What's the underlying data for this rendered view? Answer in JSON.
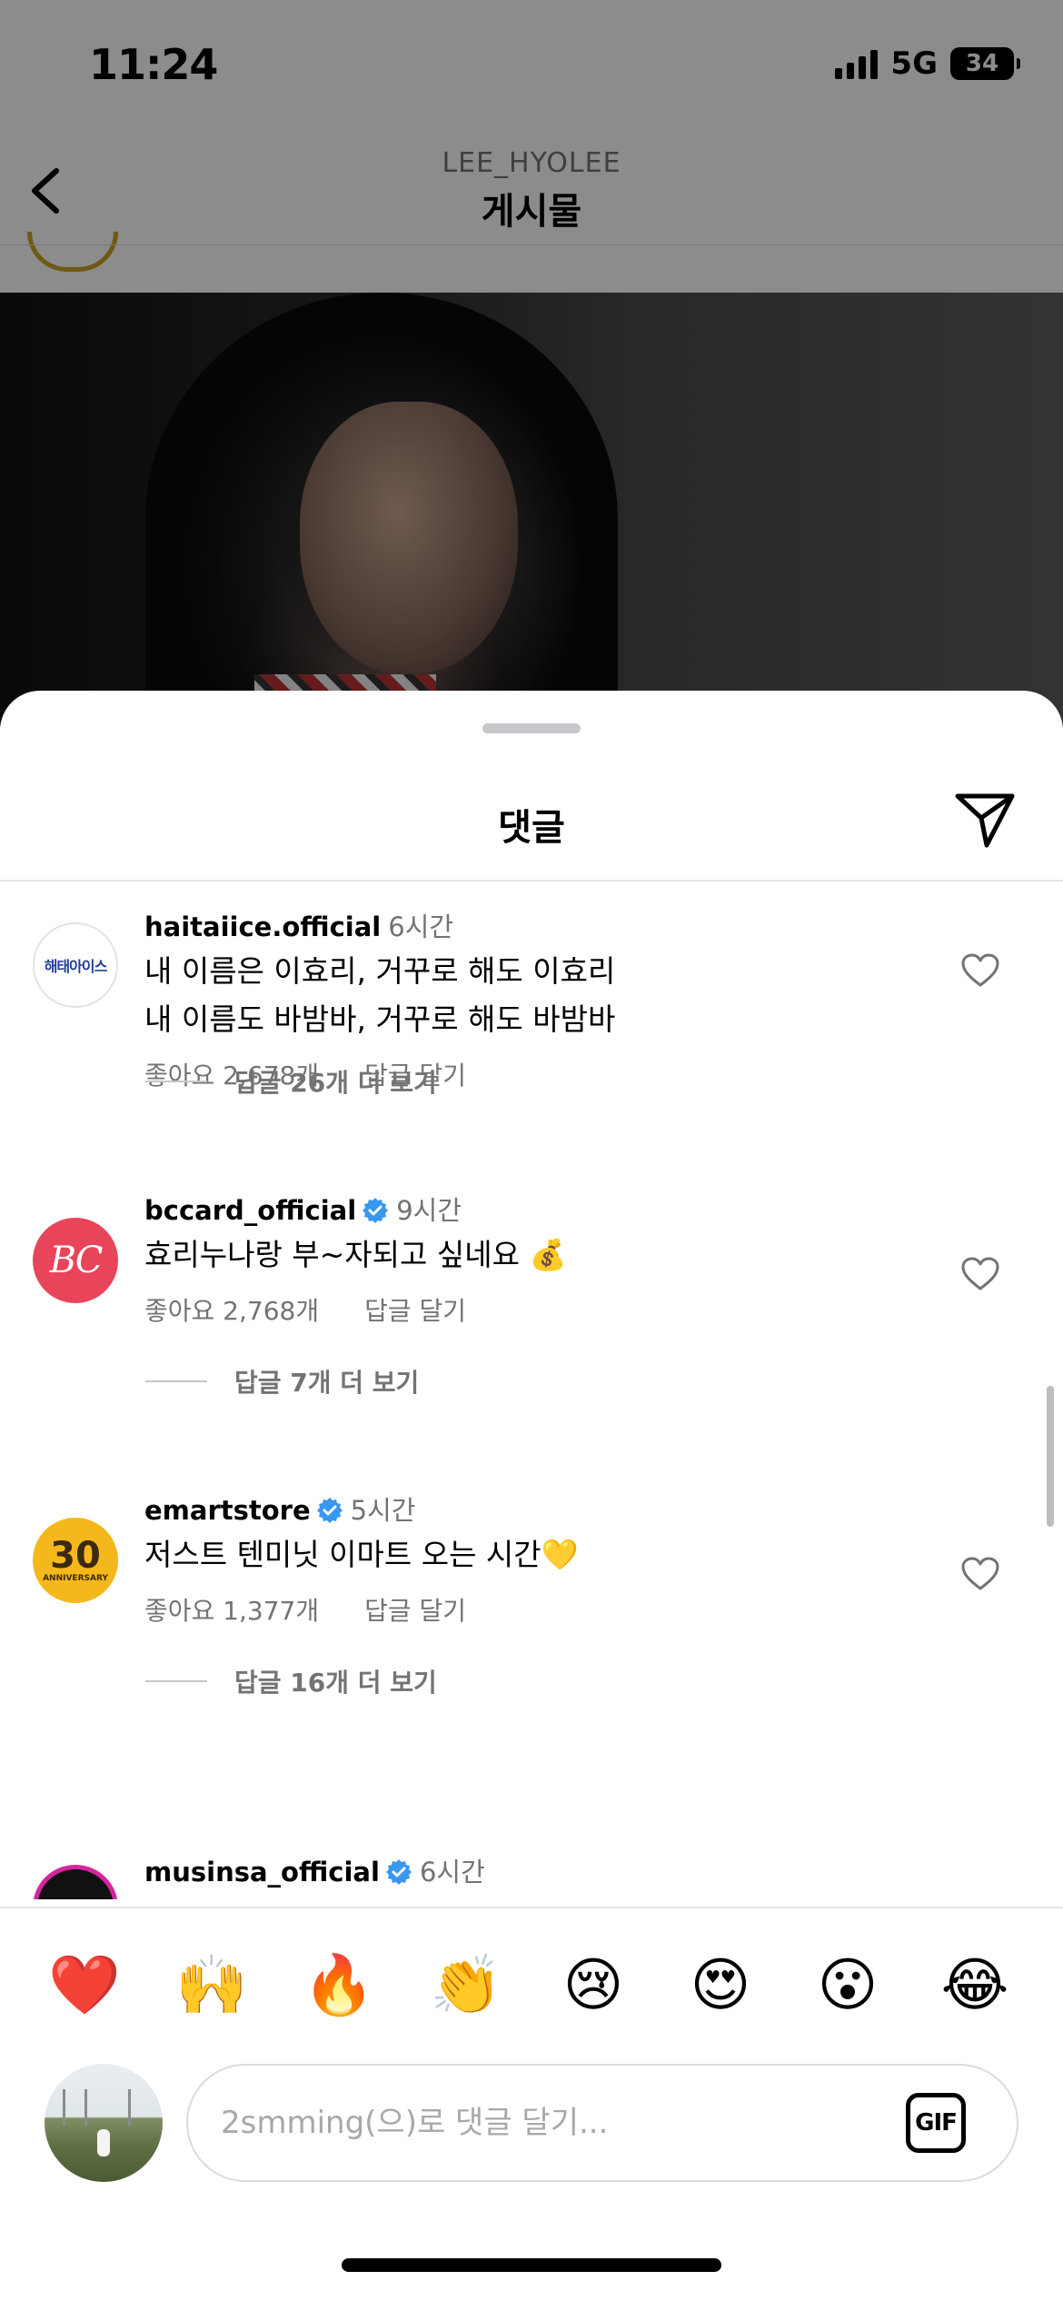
{
  "status_bar": {
    "time": "11:24",
    "network": "5G",
    "battery": "34"
  },
  "post_header": {
    "username": "LEE_HYOLEE",
    "title": "게시물"
  },
  "sheet": {
    "title": "댓글"
  },
  "comments": [
    {
      "username": "haitaiice.official",
      "verified": false,
      "time": "6시간",
      "avatar_text": "해태아이스",
      "lines": [
        "내 이름은 이효리, 거꾸로 해도 이효리",
        "내 이름도 바밤바, 거꾸로 해도 바밤바"
      ],
      "likes": "좋아요 2,678개",
      "reply_label": "답글 달기",
      "view_replies": "답글 26개 더 보기"
    },
    {
      "username": "bccard_official",
      "verified": true,
      "time": "9시간",
      "avatar_text": "BC",
      "lines": [
        "효리누나랑 부~자되고 싶네요 💰"
      ],
      "likes": "좋아요 2,768개",
      "reply_label": "답글 달기",
      "view_replies": "답글 7개 더 보기"
    },
    {
      "username": "emartstore",
      "verified": true,
      "time": "5시간",
      "avatar_text": "30",
      "avatar_subtext": "ANNIVERSARY",
      "lines": [
        "저스트 텐미닛 이마트 오는 시간💛"
      ],
      "likes": "좋아요 1,377개",
      "reply_label": "답글 달기",
      "view_replies": "답글 16개 더 보기"
    },
    {
      "username": "musinsa_official",
      "verified": true,
      "time": "6시간"
    }
  ],
  "emoji_row": [
    "❤️",
    "🙌",
    "🔥",
    "👏",
    "😢",
    "😍",
    "😮",
    "😂"
  ],
  "input": {
    "placeholder": "2smming(으)로 댓글 달기...",
    "gif_label": "GIF"
  },
  "colors": {
    "secondary_text": "#737373",
    "verified_blue": "#3897f0",
    "bc_red": "#e8455a",
    "emart_yellow": "#f5b81c"
  }
}
